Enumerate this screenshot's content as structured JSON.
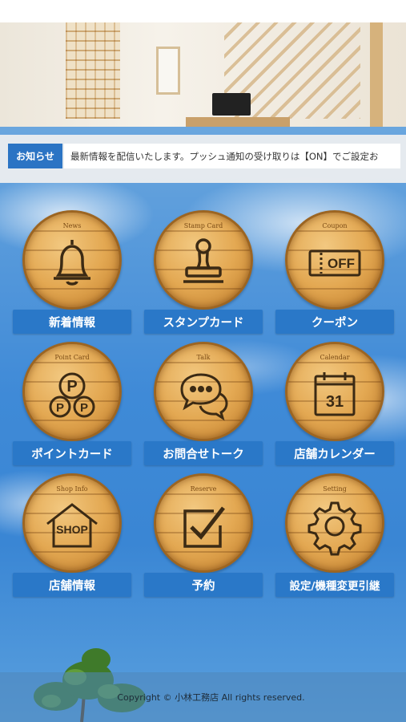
{
  "notice": {
    "label": "お知らせ",
    "text": "最新情報を配信いたします。プッシュ通知の受け取りは【ON】でご設定お"
  },
  "tiles": [
    {
      "caption": "News",
      "label": "新着情報",
      "icon": "bell-icon"
    },
    {
      "caption": "Stamp Card",
      "label": "スタンプカード",
      "icon": "stamp-icon"
    },
    {
      "caption": "Coupon",
      "label": "クーポン",
      "icon": "coupon-icon",
      "icon_text": "OFF"
    },
    {
      "caption": "Point Card",
      "label": "ポイントカード",
      "icon": "points-icon",
      "icon_text": "P"
    },
    {
      "caption": "Talk",
      "label": "お問合せトーク",
      "icon": "chat-bubbles-icon"
    },
    {
      "caption": "Calendar",
      "label": "店舗カレンダー",
      "icon": "calendar-icon",
      "icon_text": "31"
    },
    {
      "caption": "Shop Info",
      "label": "店舗情報",
      "icon": "shop-house-icon",
      "icon_text": "SHOP"
    },
    {
      "caption": "Reserve",
      "label": "予約",
      "icon": "checkbox-icon"
    },
    {
      "caption": "Setting",
      "label": "設定/機種変更引継",
      "icon": "gear-icon"
    }
  ],
  "footer": {
    "copyright": "Copyright © 小林工務店 All rights reserved."
  },
  "colors": {
    "accent": "#2a78c8",
    "notice_label": "#2b74c4",
    "wood": "#e3a852"
  }
}
